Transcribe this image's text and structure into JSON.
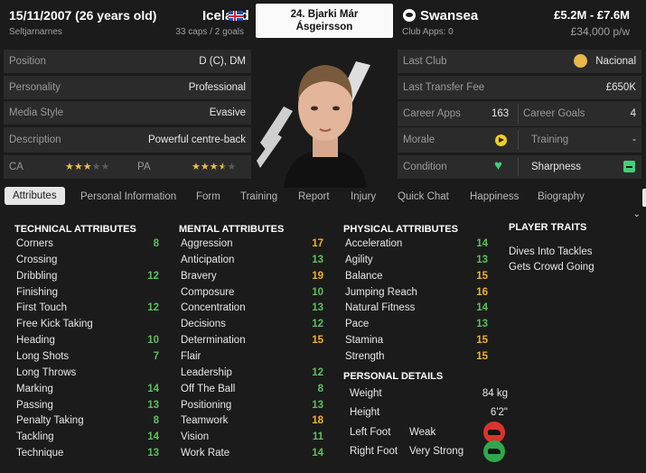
{
  "header": {
    "dob": "15/11/2007 (26 years old)",
    "birthplace": "Seltjarnarnes",
    "nation": "Iceland",
    "caps": "33 caps / 2 goals",
    "player_name_line1": "24. Bjarki Már",
    "player_name_line2": "Ásgeirsson",
    "club": "Swansea",
    "club_apps": "Club Apps: 0",
    "value": "£5.2M - £7.6M",
    "wage": "£34,000 p/w"
  },
  "left_info": [
    {
      "label": "Position",
      "value": "D (C), DM"
    },
    {
      "label": "Personality",
      "value": "Professional"
    },
    {
      "label": "Media Style",
      "value": "Evasive"
    },
    {
      "label": "Description",
      "value": "Powerful centre-back"
    }
  ],
  "ratings": {
    "ca_label": "CA",
    "pa_label": "PA",
    "ca_stars": 3,
    "pa_stars": 3.5
  },
  "right_info": {
    "last_club_label": "Last Club",
    "last_club": "Nacional",
    "transfer_label": "Last Transfer Fee",
    "transfer": "£650K",
    "career_apps_label": "Career Apps",
    "career_apps": "163",
    "career_goals_label": "Career Goals",
    "career_goals": "4",
    "morale_label": "Morale",
    "training_label": "Training",
    "training": "-",
    "condition_label": "Condition",
    "sharpness_label": "Sharpness"
  },
  "tabs": [
    "Attributes",
    "Personal Information",
    "Form",
    "Training",
    "Report",
    "Injury",
    "Quick Chat",
    "Happiness",
    "Biography"
  ],
  "technical": {
    "title": "TECHNICAL ATTRIBUTES",
    "items": [
      {
        "name": "Corners",
        "value": "8"
      },
      {
        "name": "Crossing",
        "value": ""
      },
      {
        "name": "Dribbling",
        "value": "12"
      },
      {
        "name": "Finishing",
        "value": ""
      },
      {
        "name": "First Touch",
        "value": "12"
      },
      {
        "name": "Free Kick Taking",
        "value": ""
      },
      {
        "name": "Heading",
        "value": "10"
      },
      {
        "name": "Long Shots",
        "value": "7"
      },
      {
        "name": "Long Throws",
        "value": ""
      },
      {
        "name": "Marking",
        "value": "14"
      },
      {
        "name": "Passing",
        "value": "13"
      },
      {
        "name": "Penalty Taking",
        "value": "8"
      },
      {
        "name": "Tackling",
        "value": "14"
      },
      {
        "name": "Technique",
        "value": "13"
      }
    ]
  },
  "mental": {
    "title": "MENTAL ATTRIBUTES",
    "items": [
      {
        "name": "Aggression",
        "value": "17"
      },
      {
        "name": "Anticipation",
        "value": "13"
      },
      {
        "name": "Bravery",
        "value": "19"
      },
      {
        "name": "Composure",
        "value": "10"
      },
      {
        "name": "Concentration",
        "value": "13"
      },
      {
        "name": "Decisions",
        "value": "12"
      },
      {
        "name": "Determination",
        "value": "15"
      },
      {
        "name": "Flair",
        "value": ""
      },
      {
        "name": "Leadership",
        "value": "12"
      },
      {
        "name": "Off The Ball",
        "value": "8"
      },
      {
        "name": "Positioning",
        "value": "13"
      },
      {
        "name": "Teamwork",
        "value": "18"
      },
      {
        "name": "Vision",
        "value": "11"
      },
      {
        "name": "Work Rate",
        "value": "14"
      }
    ]
  },
  "physical": {
    "title": "PHYSICAL ATTRIBUTES",
    "items": [
      {
        "name": "Acceleration",
        "value": "14"
      },
      {
        "name": "Agility",
        "value": "13"
      },
      {
        "name": "Balance",
        "value": "15"
      },
      {
        "name": "Jumping Reach",
        "value": "16"
      },
      {
        "name": "Natural Fitness",
        "value": "14"
      },
      {
        "name": "Pace",
        "value": "13"
      },
      {
        "name": "Stamina",
        "value": "15"
      },
      {
        "name": "Strength",
        "value": "15"
      }
    ]
  },
  "personal": {
    "title": "PERSONAL DETAILS",
    "weight_label": "Weight",
    "weight": "84 kg",
    "height_label": "Height",
    "height": "6'2\"",
    "left_foot_label": "Left Foot",
    "left_foot": "Weak",
    "right_foot_label": "Right Foot",
    "right_foot": "Very Strong"
  },
  "traits": {
    "title": "PLAYER TRAITS",
    "items": [
      "Dives Into Tackles",
      "Gets Crowd Going"
    ]
  },
  "colors": {
    "green": "#5fbf5f",
    "yellow": "#f0b429",
    "red": "#d9342b"
  }
}
